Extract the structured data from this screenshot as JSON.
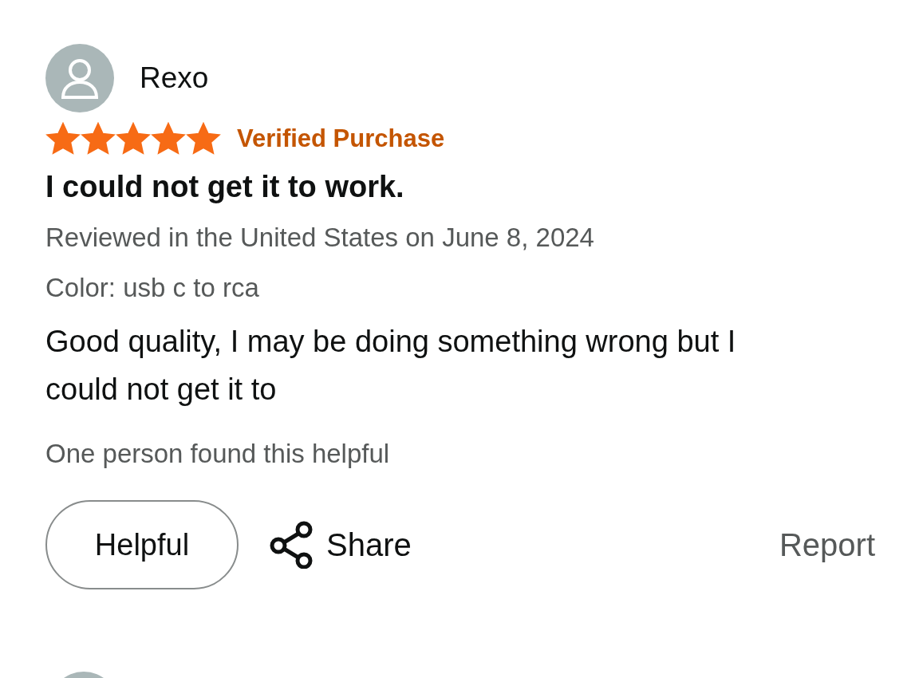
{
  "review": {
    "author": "Rexo",
    "stars": 5,
    "verified_label": "Verified Purchase",
    "title": "I could not get it to work.",
    "meta": "Reviewed in the United States on June 8, 2024",
    "variant": "Color: usb c to rca",
    "body": "Good quality, I may be doing something wrong but I could not get it to",
    "helpful_count": "One person found this helpful",
    "actions": {
      "helpful": "Helpful",
      "share": "Share",
      "report": "Report"
    }
  }
}
